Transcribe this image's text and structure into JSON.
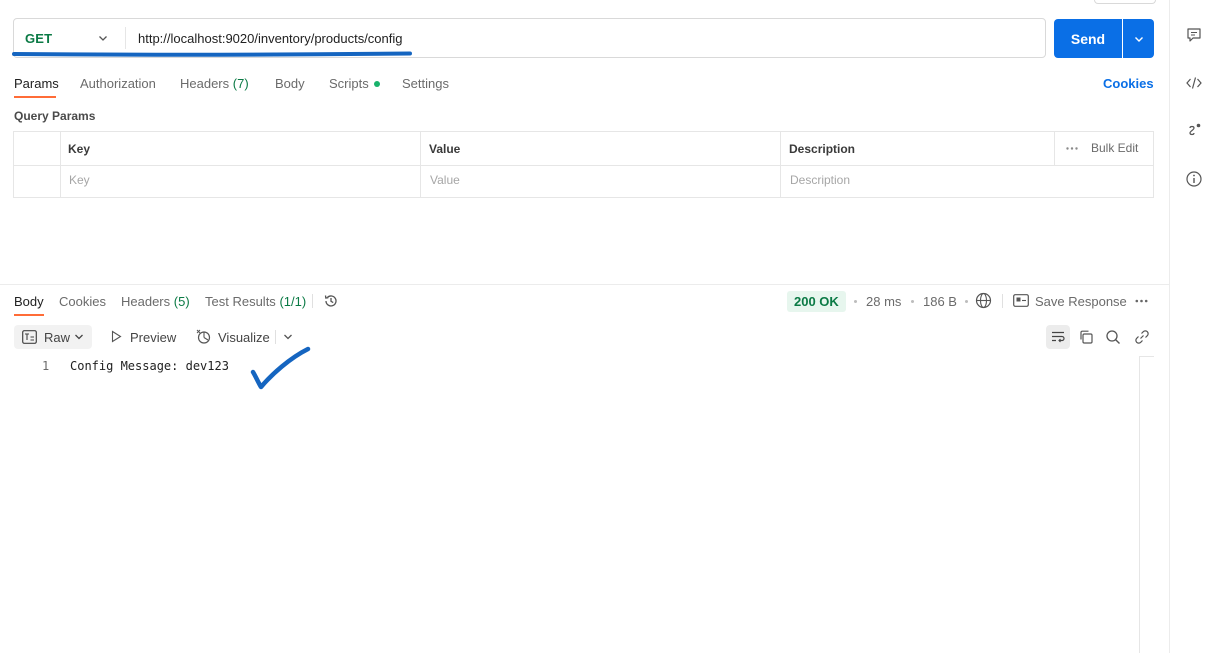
{
  "request": {
    "method": "GET",
    "url": "http://localhost:9020/inventory/products/config",
    "send_label": "Send"
  },
  "request_tabs": {
    "params": "Params",
    "authorization": "Authorization",
    "headers": "Headers",
    "headers_count": "(7)",
    "body": "Body",
    "scripts": "Scripts",
    "settings": "Settings",
    "cookies": "Cookies"
  },
  "query_params": {
    "title": "Query Params",
    "columns": {
      "key": "Key",
      "value": "Value",
      "description": "Description"
    },
    "bulk_edit": "Bulk Edit",
    "placeholders": {
      "key": "Key",
      "value": "Value",
      "description": "Description"
    }
  },
  "response_tabs": {
    "body": "Body",
    "cookies": "Cookies",
    "headers": "Headers",
    "headers_count": "(5)",
    "test_results": "Test Results",
    "test_results_count": "(1/1)"
  },
  "response_meta": {
    "status": "200 OK",
    "time": "28 ms",
    "size": "186 B",
    "save_response": "Save Response"
  },
  "response_toolbar": {
    "format": "Raw",
    "preview": "Preview",
    "visualize": "Visualize"
  },
  "response_body": {
    "lines": [
      {
        "number": "1",
        "text": "Config Message: dev123"
      }
    ]
  },
  "colors": {
    "accent_orange": "#ff6c37",
    "send_blue": "#0a6fe6",
    "method_green": "#0b7a45",
    "annotation_blue": "#1565c0"
  }
}
